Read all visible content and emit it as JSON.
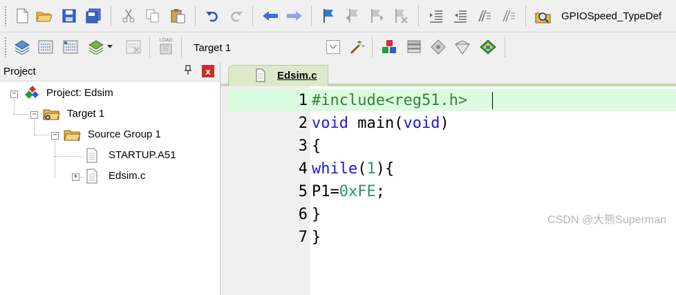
{
  "toolbar1": {
    "buttons": [
      "new-file-icon",
      "open-folder-icon",
      "save-icon",
      "save-all-icon",
      "cut-icon",
      "copy-icon",
      "paste-icon",
      "undo-icon",
      "redo-icon",
      "nav-back-icon",
      "nav-forward-icon",
      "bookmark-icon",
      "bookmark-prev-icon",
      "bookmark-next-icon",
      "bookmark-clear-icon",
      "indent-icon",
      "unindent-icon",
      "comment-icon",
      "uncomment-icon",
      "find-in-files-icon"
    ],
    "find_label": "GPIOSpeed_TypeDef"
  },
  "toolbar2": {
    "buttons": [
      "translate-icon",
      "build-icon",
      "rebuild-icon",
      "batch-build-icon",
      "stop-build-icon",
      "download-icon",
      "target-options-icon",
      "manage-components-icon",
      "books-icon",
      "functions-icon",
      "templates-icon",
      "pack-installer-icon"
    ],
    "download_caption": "LOAD",
    "target_value": "Target 1"
  },
  "project_panel": {
    "title": "Project",
    "pin": "ꟷ",
    "close": "x",
    "tree": {
      "project": "Project: Edsim",
      "target": "Target 1",
      "group": "Source Group 1",
      "file1": "STARTUP.A51",
      "file2": "Edsim.c"
    },
    "expander_minus": "−",
    "expander_plus": "+"
  },
  "editor": {
    "tab": "Edsim.c",
    "line_numbers": [
      "1",
      "2",
      "3",
      "4",
      "5",
      "6",
      "7"
    ],
    "code": {
      "l1": "#include<reg51.h>",
      "l2a": "void",
      "l2b": " main(",
      "l2c": "void",
      "l2d": ")",
      "l3": "{",
      "l4a": "while",
      "l4b": "(",
      "l4c": "1",
      "l4d": "){",
      "l5a": "P1=",
      "l5b": "0xFE",
      "l5c": ";",
      "l6": "}",
      "l7": "}"
    }
  },
  "watermark": "CSDN @大熊Superman",
  "colors": {
    "keyword": "#1a1adc",
    "preprocessor": "#3d7d3d",
    "number": "#2e8f7a",
    "line_highlight": "#dcfce0",
    "tab_active": "#ddeac9"
  }
}
